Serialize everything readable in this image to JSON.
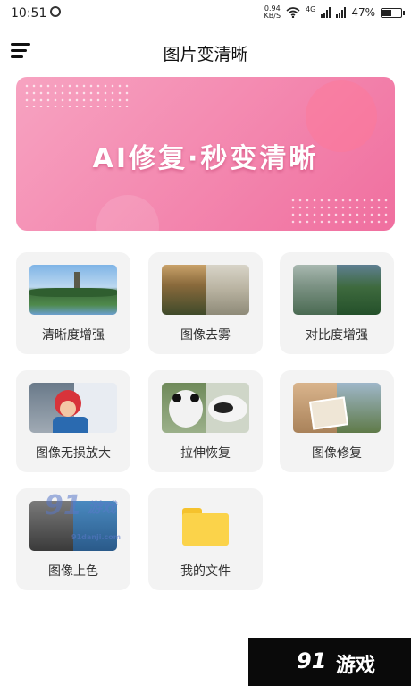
{
  "status_bar": {
    "time": "10:51",
    "net_speed_value": "0.94",
    "net_speed_unit": "KB/S",
    "network_type": "4G",
    "battery": "47%",
    "battery_level": 0.47,
    "icons": [
      "alarm-icon",
      "wifi-icon",
      "signal-icon",
      "battery-icon"
    ]
  },
  "app_bar": {
    "title": "图片变清晰",
    "menu_icon": "hamburger-menu-icon"
  },
  "banner": {
    "text": "AI修复·秒变清晰",
    "colors": [
      "#f7a3c1",
      "#f06f9f"
    ]
  },
  "features": [
    {
      "label": "清晰度增强",
      "icon": "landscape-thumbnail"
    },
    {
      "label": "图像去雾",
      "icon": "forest-fog-thumbnail"
    },
    {
      "label": "对比度增强",
      "icon": "mountain-thumbnail"
    },
    {
      "label": "图像无损放大",
      "icon": "child-thumbnail"
    },
    {
      "label": "拉伸恢复",
      "icon": "panda-thumbnail"
    },
    {
      "label": "图像修复",
      "icon": "old-photo-thumbnail"
    },
    {
      "label": "图像上色",
      "icon": "colorize-thumbnail"
    },
    {
      "label": "我的文件",
      "icon": "folder-icon"
    }
  ],
  "watermark": {
    "mid_logo": "91",
    "mid_text": "游戏",
    "mid_url": "91danji.com",
    "corner_logo": "91",
    "corner_text": "游戏"
  }
}
